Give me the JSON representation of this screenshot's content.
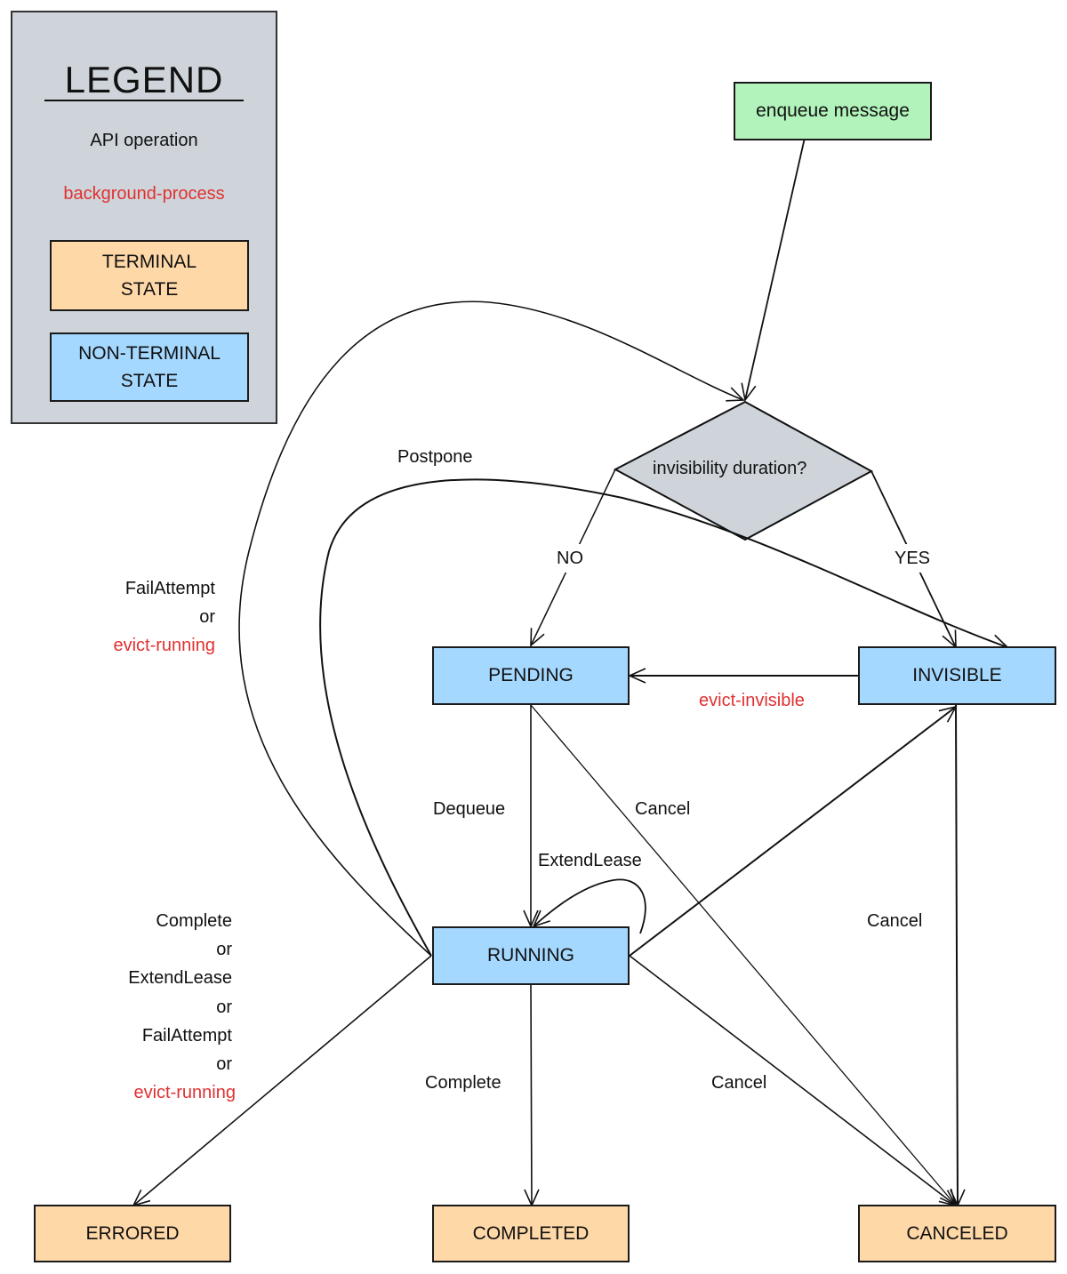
{
  "legend": {
    "title": "LEGEND",
    "api_operation": "API operation",
    "background_process": "background-process",
    "terminal_state": [
      "TERMINAL",
      "STATE"
    ],
    "non_terminal_state": [
      "NON-TERMINAL",
      "STATE"
    ]
  },
  "colors": {
    "non_terminal": "#a5d8ff",
    "terminal": "#ffd8a8",
    "start": "#b2f2bb",
    "decision": "#ced4da",
    "background_process_text": "#e03131"
  },
  "nodes": {
    "enqueue": "enqueue message",
    "decision": "invisibility duration?",
    "pending": "PENDING",
    "invisible": "INVISIBLE",
    "running": "RUNNING",
    "errored": "ERRORED",
    "completed": "COMPLETED",
    "canceled": "CANCELED"
  },
  "edges": {
    "no": "NO",
    "yes": "YES",
    "postpone": "Postpone",
    "fail_attempt": [
      "FailAttempt",
      "or"
    ],
    "evict_running_top": "evict-running",
    "evict_invisible": "evict-invisible",
    "dequeue": "Dequeue",
    "cancel_pending": "Cancel",
    "extend_lease_loop": "ExtendLease",
    "cancel_invisible": "Cancel",
    "errored_ops": [
      "Complete",
      "or",
      "ExtendLease",
      "or",
      "FailAttempt",
      "or"
    ],
    "evict_running_bottom": "evict-running",
    "complete": "Complete",
    "cancel_running": "Cancel"
  }
}
